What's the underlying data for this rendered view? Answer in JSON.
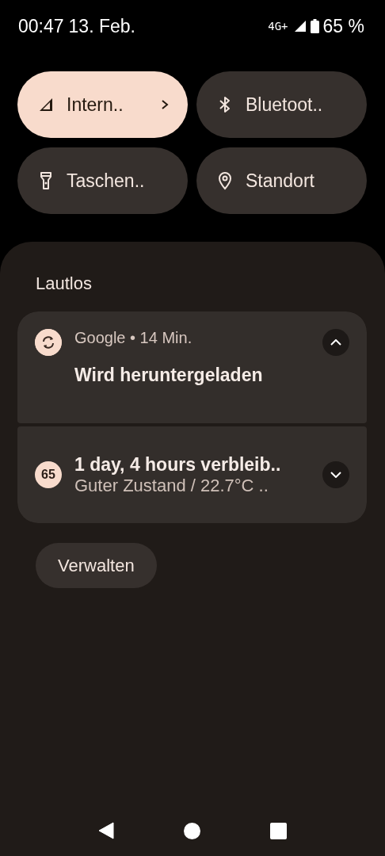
{
  "status_bar": {
    "time": "00:47",
    "date": "13. Feb.",
    "network": "4G+",
    "battery": "65 %"
  },
  "tiles": [
    {
      "label": "Intern..",
      "on": true,
      "chevron": true
    },
    {
      "label": "Bluetoot..",
      "on": false,
      "chevron": false
    },
    {
      "label": "Taschen..",
      "on": false,
      "chevron": false
    },
    {
      "label": "Standort",
      "on": false,
      "chevron": false
    }
  ],
  "section_title": "Lautlos",
  "notifications": [
    {
      "header": "Google • 14 Min.",
      "title": "Wird heruntergeladen",
      "expanded": true
    },
    {
      "badge": "65",
      "title": "1 day, 4 hours verbleib..",
      "text": "Guter Zustand / 22.7°C ..",
      "expanded": false
    }
  ],
  "manage_button": "Verwalten"
}
